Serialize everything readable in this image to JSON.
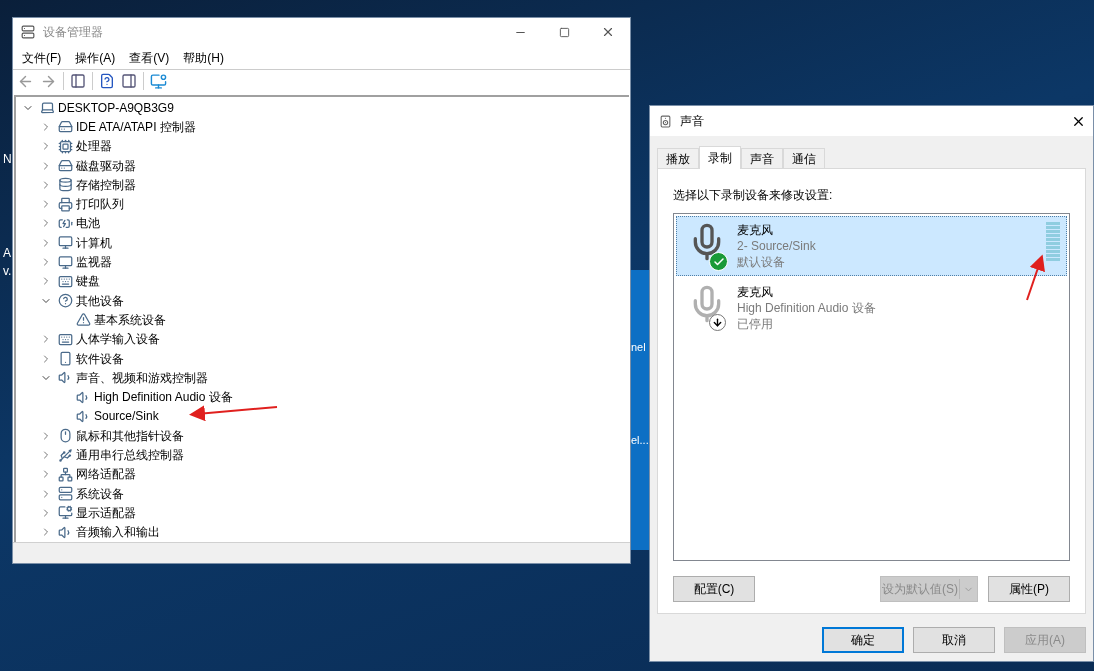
{
  "desktop": {
    "left_labels": [
      "N",
      "A",
      "v."
    ],
    "right_labels": [
      "nel",
      "el..."
    ]
  },
  "device_manager": {
    "title": "设备管理器",
    "menu": [
      "文件(F)",
      "操作(A)",
      "查看(V)",
      "帮助(H)"
    ],
    "tree": {
      "label": "DESKTOP-A9QB3G9",
      "expanded": true,
      "children": [
        {
          "label": "IDE ATA/ATAPI 控制器",
          "expanded": false
        },
        {
          "label": "处理器",
          "expanded": false
        },
        {
          "label": "磁盘驱动器",
          "expanded": false
        },
        {
          "label": "存储控制器",
          "expanded": false
        },
        {
          "label": "打印队列",
          "expanded": false
        },
        {
          "label": "电池",
          "expanded": false
        },
        {
          "label": "计算机",
          "expanded": false
        },
        {
          "label": "监视器",
          "expanded": false
        },
        {
          "label": "键盘",
          "expanded": false
        },
        {
          "label": "其他设备",
          "expanded": true,
          "children": [
            {
              "label": "基本系统设备"
            }
          ]
        },
        {
          "label": "人体学输入设备",
          "expanded": false
        },
        {
          "label": "软件设备",
          "expanded": false
        },
        {
          "label": "声音、视频和游戏控制器",
          "expanded": true,
          "children": [
            {
              "label": "High Definition Audio 设备"
            },
            {
              "label": "Source/Sink"
            }
          ]
        },
        {
          "label": "鼠标和其他指针设备",
          "expanded": false
        },
        {
          "label": "通用串行总线控制器",
          "expanded": false
        },
        {
          "label": "网络适配器",
          "expanded": false
        },
        {
          "label": "系统设备",
          "expanded": false
        },
        {
          "label": "显示适配器",
          "expanded": false
        },
        {
          "label": "音频输入和输出",
          "expanded": false
        }
      ]
    }
  },
  "sound_dialog": {
    "title": "声音",
    "tabs": [
      {
        "label": "播放",
        "selected": false
      },
      {
        "label": "录制",
        "selected": true
      },
      {
        "label": "声音",
        "selected": false
      },
      {
        "label": "通信",
        "selected": false
      }
    ],
    "instruction": "选择以下录制设备来修改设置:",
    "devices": [
      {
        "name": "麦克风",
        "detail": "2- Source/Sink",
        "status": "默认设备",
        "kind": "default",
        "selected": true,
        "meter": true
      },
      {
        "name": "麦克风",
        "detail": "High Definition Audio 设备",
        "status": "已停用",
        "kind": "disabled",
        "selected": false
      }
    ],
    "configure": {
      "label": "配置(C)",
      "disabled": false
    },
    "set_default": {
      "label": "设为默认值(S)",
      "disabled": true
    },
    "properties": {
      "label": "属性(P)",
      "disabled": false
    },
    "footer_buttons": [
      {
        "label": "确定",
        "disabled": false,
        "focused": true
      },
      {
        "label": "取消",
        "disabled": false,
        "focused": false
      },
      {
        "label": "应用(A)",
        "disabled": true,
        "focused": false
      }
    ]
  }
}
